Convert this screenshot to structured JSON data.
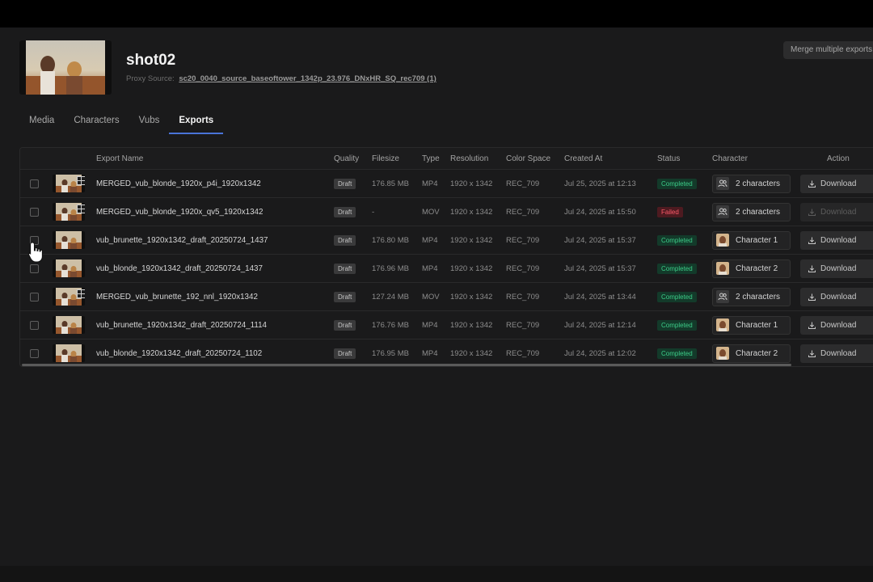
{
  "shot": {
    "title": "shot02",
    "proxy_label": "Proxy Source:",
    "proxy_source": "sc20_0040_source_baseoftower_1342p_23.976_DNxHR_SQ_rec709 (1)"
  },
  "merge_button_label": "Merge multiple exports",
  "tabs": [
    {
      "label": "Media",
      "active": false
    },
    {
      "label": "Characters",
      "active": false
    },
    {
      "label": "Vubs",
      "active": false
    },
    {
      "label": "Exports",
      "active": true
    }
  ],
  "table": {
    "headers": {
      "export_name": "Export Name",
      "quality": "Quality",
      "filesize": "Filesize",
      "type": "Type",
      "resolution": "Resolution",
      "color_space": "Color Space",
      "created_at": "Created At",
      "status": "Status",
      "character": "Character",
      "action": "Action"
    },
    "rows": [
      {
        "name": "MERGED_vub_blonde_1920x_p4i_1920x1342",
        "merged": true,
        "quality": "Draft",
        "filesize": "176.85 MB",
        "type": "MP4",
        "resolution": "1920 x 1342",
        "color_space": "REC_709",
        "created_at": "Jul 25, 2025 at 12:13",
        "status": "Completed",
        "character": "2 characters",
        "character_icon": "users-icon",
        "action": "Download",
        "action_enabled": true
      },
      {
        "name": "MERGED_vub_blonde_1920x_qv5_1920x1342",
        "merged": true,
        "quality": "Draft",
        "filesize": "-",
        "type": "MOV",
        "resolution": "1920 x 1342",
        "color_space": "REC_709",
        "created_at": "Jul 24, 2025 at 15:50",
        "status": "Failed",
        "character": "2 characters",
        "character_icon": "users-icon",
        "action": "Download",
        "action_enabled": false
      },
      {
        "name": "vub_brunette_1920x1342_draft_20250724_1437",
        "merged": false,
        "quality": "Draft",
        "filesize": "176.80 MB",
        "type": "MP4",
        "resolution": "1920 x 1342",
        "color_space": "REC_709",
        "created_at": "Jul 24, 2025 at 15:37",
        "status": "Completed",
        "character": "Character 1",
        "character_icon": "avatar",
        "action": "Download",
        "action_enabled": true
      },
      {
        "name": "vub_blonde_1920x1342_draft_20250724_1437",
        "merged": false,
        "quality": "Draft",
        "filesize": "176.96 MB",
        "type": "MP4",
        "resolution": "1920 x 1342",
        "color_space": "REC_709",
        "created_at": "Jul 24, 2025 at 15:37",
        "status": "Completed",
        "character": "Character 2",
        "character_icon": "avatar",
        "action": "Download",
        "action_enabled": true
      },
      {
        "name": "MERGED_vub_brunette_192_nnl_1920x1342",
        "merged": true,
        "quality": "Draft",
        "filesize": "127.24 MB",
        "type": "MOV",
        "resolution": "1920 x 1342",
        "color_space": "REC_709",
        "created_at": "Jul 24, 2025 at 13:44",
        "status": "Completed",
        "character": "2 characters",
        "character_icon": "users-icon",
        "action": "Download",
        "action_enabled": true
      },
      {
        "name": "vub_brunette_1920x1342_draft_20250724_1114",
        "merged": false,
        "quality": "Draft",
        "filesize": "176.76 MB",
        "type": "MP4",
        "resolution": "1920 x 1342",
        "color_space": "REC_709",
        "created_at": "Jul 24, 2025 at 12:14",
        "status": "Completed",
        "character": "Character 1",
        "character_icon": "avatar",
        "action": "Download",
        "action_enabled": true
      },
      {
        "name": "vub_blonde_1920x1342_draft_20250724_1102",
        "merged": false,
        "quality": "Draft",
        "filesize": "176.95 MB",
        "type": "MP4",
        "resolution": "1920 x 1342",
        "color_space": "REC_709",
        "created_at": "Jul 24, 2025 at 12:02",
        "status": "Completed",
        "character": "Character 2",
        "character_icon": "avatar",
        "action": "Download",
        "action_enabled": true
      }
    ]
  },
  "colors": {
    "accent": "#4a74d8",
    "status_completed": "#3ccd88",
    "status_failed": "#ff5b6b"
  }
}
